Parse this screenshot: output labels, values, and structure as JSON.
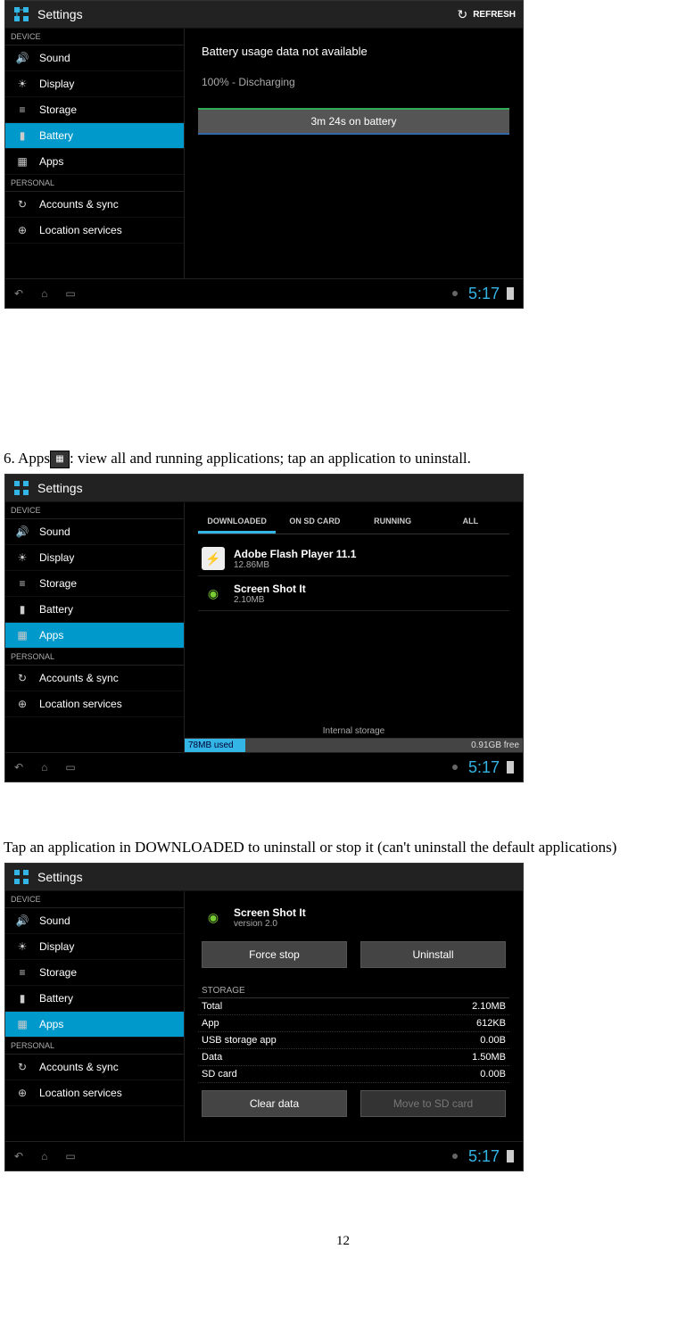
{
  "header": {
    "title": "Settings",
    "refresh": "REFRESH"
  },
  "sidebar": {
    "section1": "DEVICE",
    "section2": "PERSONAL",
    "items": [
      "Sound",
      "Display",
      "Storage",
      "Battery",
      "Apps",
      "Accounts & sync",
      "Location services"
    ]
  },
  "screen1": {
    "selected": "Battery",
    "line1": "Battery usage data not available",
    "line2": "100% - Discharging",
    "bar": "3m 24s on battery"
  },
  "screen2": {
    "selected": "Apps",
    "tabs": [
      "DOWNLOADED",
      "ON SD CARD",
      "RUNNING",
      "ALL"
    ],
    "apps": [
      {
        "name": "Adobe Flash Player 11.1",
        "size": "12.86MB",
        "icon": "flash"
      },
      {
        "name": "Screen Shot It",
        "size": "2.10MB",
        "icon": "android"
      }
    ],
    "storage_title": "Internal storage",
    "used": "78MB used",
    "free": "0.91GB free"
  },
  "screen3": {
    "selected": "Apps",
    "app_name": "Screen Shot It",
    "version": "version 2.0",
    "btn_force": "Force stop",
    "btn_uninstall": "Uninstall",
    "sec_storage": "STORAGE",
    "rows": [
      {
        "label": "Total",
        "value": "2.10MB"
      },
      {
        "label": "App",
        "value": "612KB"
      },
      {
        "label": "USB storage app",
        "value": "0.00B"
      },
      {
        "label": "Data",
        "value": "1.50MB"
      },
      {
        "label": "SD card",
        "value": "0.00B"
      }
    ],
    "btn_clear": "Clear data",
    "btn_move": "Move to SD card"
  },
  "nav": {
    "clock": "5:17"
  },
  "doc": {
    "line1a": "6. Apps",
    "line1b": ": view all and running applications; tap an application to uninstall.",
    "line2": "Tap an application in DOWNLOADED to uninstall or stop it (can't uninstall the default applications)",
    "pagenum": "12"
  }
}
